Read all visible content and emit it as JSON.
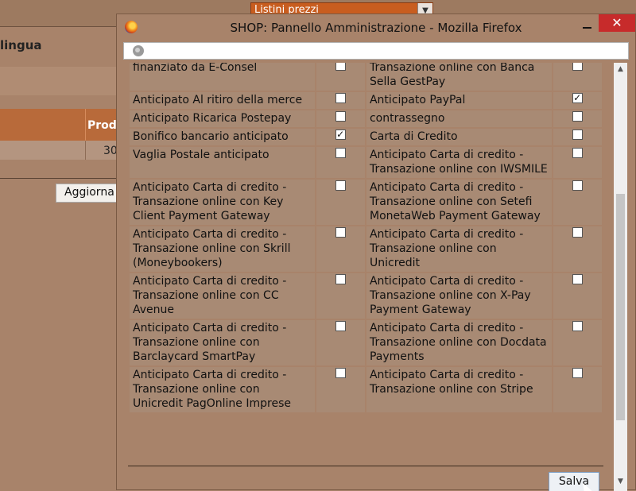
{
  "background": {
    "select_value": "Listini prezzi",
    "lingua_label": "lingua",
    "column_header": "Prod",
    "cell_value": "30",
    "aggiorna_button": "Aggiorna"
  },
  "window": {
    "title": "SHOP: Pannello Amministrazione - Mozilla Firefox",
    "close_symbol": "✕",
    "save_button": "Salva",
    "rows": [
      {
        "left": {
          "label": "finanziato da E-Consel",
          "checked": false
        },
        "right": {
          "label": "Transazione online con Banca Sella GestPay",
          "checked": false
        }
      },
      {
        "left": {
          "label": "Anticipato Al ritiro della merce",
          "checked": false
        },
        "right": {
          "label": "Anticipato PayPal",
          "checked": true
        }
      },
      {
        "left": {
          "label": "Anticipato Ricarica Postepay",
          "checked": false
        },
        "right": {
          "label": "contrassegno",
          "checked": false
        }
      },
      {
        "left": {
          "label": "Bonifico bancario anticipato",
          "checked": true
        },
        "right": {
          "label": "Carta di Credito",
          "checked": false
        }
      },
      {
        "left": {
          "label": "Vaglia Postale anticipato",
          "checked": false
        },
        "right": {
          "label": "Anticipato Carta di credito - Transazione online con IWSMILE",
          "checked": false
        }
      },
      {
        "left": {
          "label": "Anticipato Carta di credito - Transazione online con Key Client Payment Gateway",
          "checked": false
        },
        "right": {
          "label": "Anticipato Carta di credito - Transazione online con Setefi MonetaWeb Payment Gateway",
          "checked": false
        }
      },
      {
        "left": {
          "label": "Anticipato Carta di credito - Transazione online con Skrill (Moneybookers)",
          "checked": false
        },
        "right": {
          "label": "Anticipato Carta di credito - Transazione online con Unicredit",
          "checked": false
        }
      },
      {
        "left": {
          "label": "Anticipato Carta di credito - Transazione online con CC Avenue",
          "checked": false
        },
        "right": {
          "label": "Anticipato Carta di credito - Transazione online con X-Pay Payment Gateway",
          "checked": false
        }
      },
      {
        "left": {
          "label": "Anticipato Carta di credito - Transazione online con Barclaycard SmartPay",
          "checked": false
        },
        "right": {
          "label": "Anticipato Carta di credito - Transazione online con Docdata Payments",
          "checked": false
        }
      },
      {
        "left": {
          "label": "Anticipato Carta di credito - Transazione online con Unicredit PagOnline Imprese",
          "checked": false
        },
        "right": {
          "label": "Anticipato Carta di credito - Transazione online con Stripe",
          "checked": false
        }
      }
    ]
  }
}
